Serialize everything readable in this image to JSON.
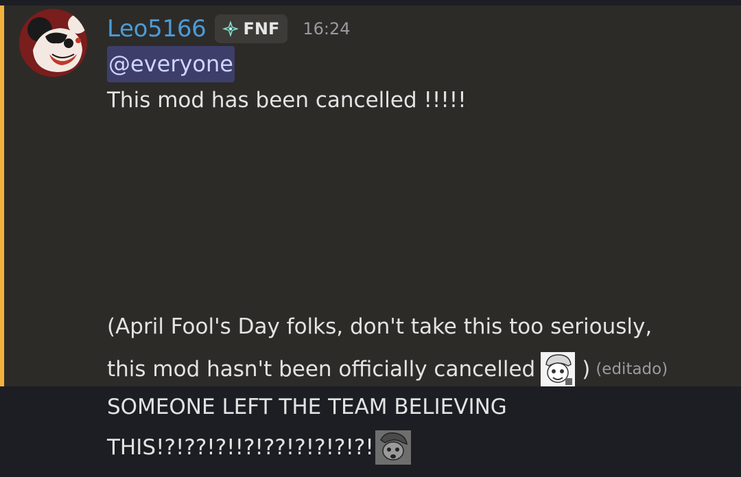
{
  "message": {
    "author": "Leo5166",
    "guild_tag": "FNF",
    "timestamp": "16:24",
    "mention": "@everyone",
    "line1": "This mod has been cancelled !!!!!",
    "line2": "(April Fool's Day folks, don't take this too seriously,",
    "line3": "this mod hasn't been officially cancelled",
    "line3_close": ")",
    "edited": "(editado)",
    "colors": {
      "author": "#4b9cd8",
      "mention_bg": "#3d3f6a",
      "mention_bar": "#f2b33d"
    }
  },
  "reply_message": {
    "line1": "SOMEONE LEFT THE TEAM BELIEVING",
    "line2": "THIS!?!??!?!!?!??!?!?!?!?!"
  },
  "icons": {
    "avatar": "mickey-avatar",
    "guild_tag_icon": "diamond-sparkle-icon",
    "emoji_1": "cartoon-face-emoji",
    "emoji_2": "sketch-face-emoji"
  }
}
